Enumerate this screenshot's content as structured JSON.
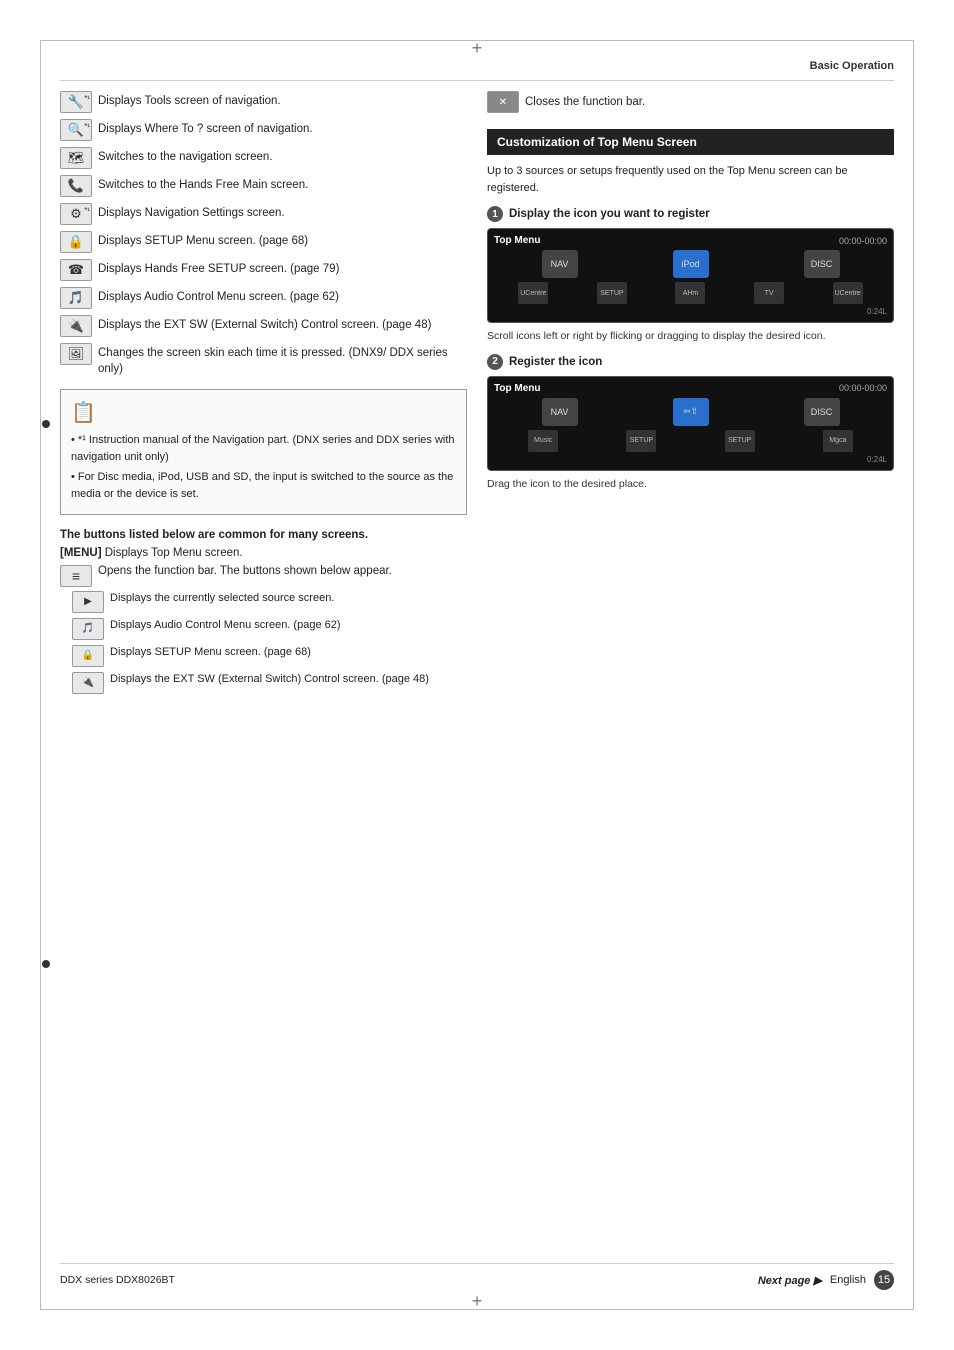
{
  "page": {
    "title": "Basic Operation",
    "footer_series": "DDX series  DDX8026BT",
    "footer_language": "English",
    "footer_page": "15",
    "next_page_label": "Next page ▶"
  },
  "left_column": {
    "icon_items": [
      {
        "icon_symbol": "🔧",
        "has_star": true,
        "text": "Displays Tools screen of navigation."
      },
      {
        "icon_symbol": "🔍",
        "has_star": true,
        "text": "Displays Where To ? screen of navigation."
      },
      {
        "icon_symbol": "🗺",
        "has_star": false,
        "text": "Switches to the navigation screen."
      },
      {
        "icon_symbol": "📞",
        "has_star": false,
        "text": "Switches to the Hands Free Main screen."
      },
      {
        "icon_symbol": "⚙",
        "has_star": true,
        "text": "Displays Navigation Settings screen."
      },
      {
        "icon_symbol": "🔒",
        "has_star": false,
        "text": "Displays SETUP Menu screen. (page 68)"
      },
      {
        "icon_symbol": "☎",
        "has_star": false,
        "text": "Displays Hands Free SETUP screen. (page 79)"
      },
      {
        "icon_symbol": "🎵",
        "has_star": false,
        "text": "Displays Audio Control Menu screen. (page 62)"
      },
      {
        "icon_symbol": "🔌",
        "has_star": false,
        "text": "Displays the EXT SW (External Switch) Control screen. (page 48)"
      },
      {
        "icon_symbol": "🖼",
        "has_star": false,
        "text": "Changes the screen skin each time it is pressed. (DNX9/ DDX series only)"
      }
    ],
    "note": {
      "icon": "📋",
      "lines": [
        "• *¹ Instruction manual of the Navigation part. (DNX series and DDX series with navigation unit only)",
        "• For Disc media, iPod, USB and SD, the input is switched to the source as the media or the device is set."
      ]
    },
    "common_section": {
      "title": "The buttons listed below are common for many screens.",
      "menu_label": "[MENU]",
      "menu_text": "Displays Top Menu screen.",
      "func_bar_icon": "≡",
      "func_bar_text": "Opens the function bar. The buttons shown below appear.",
      "sub_items": [
        {
          "icon_symbol": "▶",
          "text": "Displays the currently selected source screen."
        },
        {
          "icon_symbol": "🎵",
          "text": "Displays Audio Control Menu screen. (page 62)"
        },
        {
          "icon_symbol": "🔒",
          "text": "Displays SETUP Menu screen. (page 68)"
        },
        {
          "icon_symbol": "🔌",
          "text": "Displays the EXT SW (External Switch) Control screen. (page 48)"
        }
      ]
    }
  },
  "right_column": {
    "close_bar_icon": "✕",
    "close_bar_text": "Closes the function bar.",
    "customization": {
      "section_title": "Customization of Top Menu Screen",
      "intro": "Up to 3 sources or setups frequently used on the Top Menu screen can be registered.",
      "step1": {
        "num": "1",
        "label": "Display the icon you want to register",
        "screen": {
          "title": "Top Menu",
          "time": "00:00-00:00",
          "icons": [
            "NAV",
            "iPod",
            "DISC"
          ],
          "bottom_icons": [
            "UCentre",
            "SETUP",
            "AHm",
            "TV",
            "UCentre"
          ]
        },
        "caption": "Scroll icons left or right by flicking or dragging to display the desired icon."
      },
      "step2": {
        "num": "2",
        "label": "Register the icon",
        "screen": {
          "title": "Top Menu",
          "time": "00:00-00:00",
          "icons": [
            "NAV",
            "⇦⇧",
            "DISC"
          ],
          "bottom_icons": [
            "Music",
            "SETUP",
            "SETUP",
            "Mgca"
          ]
        },
        "caption": "Drag the icon to the desired place."
      }
    }
  }
}
